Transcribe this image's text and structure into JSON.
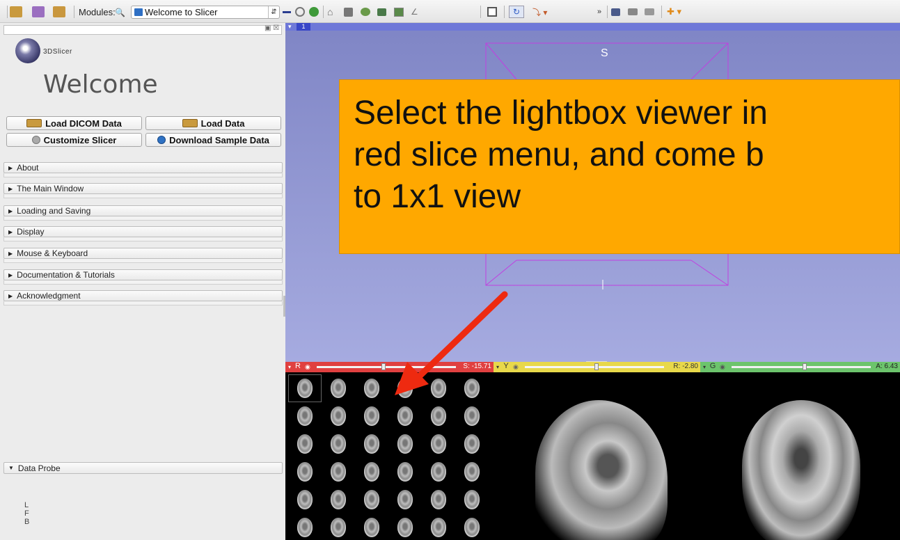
{
  "toolbar": {
    "modules_label": "Modules:",
    "module_selected": "Welcome to Slicer",
    "buttons": [
      "data-icon",
      "dcm-icon",
      "save-icon",
      "search-icon"
    ]
  },
  "panel": {
    "logo_text": "3DSlicer",
    "title": "Welcome",
    "buttons": {
      "load_dicom": "Load DICOM Data",
      "load_data": "Load Data",
      "customize": "Customize Slicer",
      "download_sample": "Download Sample Data"
    },
    "sections": [
      "About",
      "The Main Window",
      "Loading and Saving",
      "Display",
      "Mouse & Keyboard",
      "Documentation & Tutorials",
      "Acknowledgment"
    ],
    "data_probe": "Data Probe",
    "orientation": [
      "L",
      "F",
      "B"
    ]
  },
  "view3d": {
    "layout_number": "1",
    "axis_label": "S"
  },
  "callout": {
    "lines": [
      "Select the lightbox viewer in",
      "red slice menu, and come b",
      "to 1x1 view"
    ],
    "color": "#ffa800"
  },
  "slices": {
    "red": {
      "letter": "R",
      "value": "S: -15.71",
      "color": "#e04040"
    },
    "yellow": {
      "letter": "Y",
      "value": "R: -2.80",
      "color": "#e8d84a"
    },
    "green": {
      "letter": "G",
      "value": "A: 6.43",
      "color": "#6cc46c"
    }
  }
}
